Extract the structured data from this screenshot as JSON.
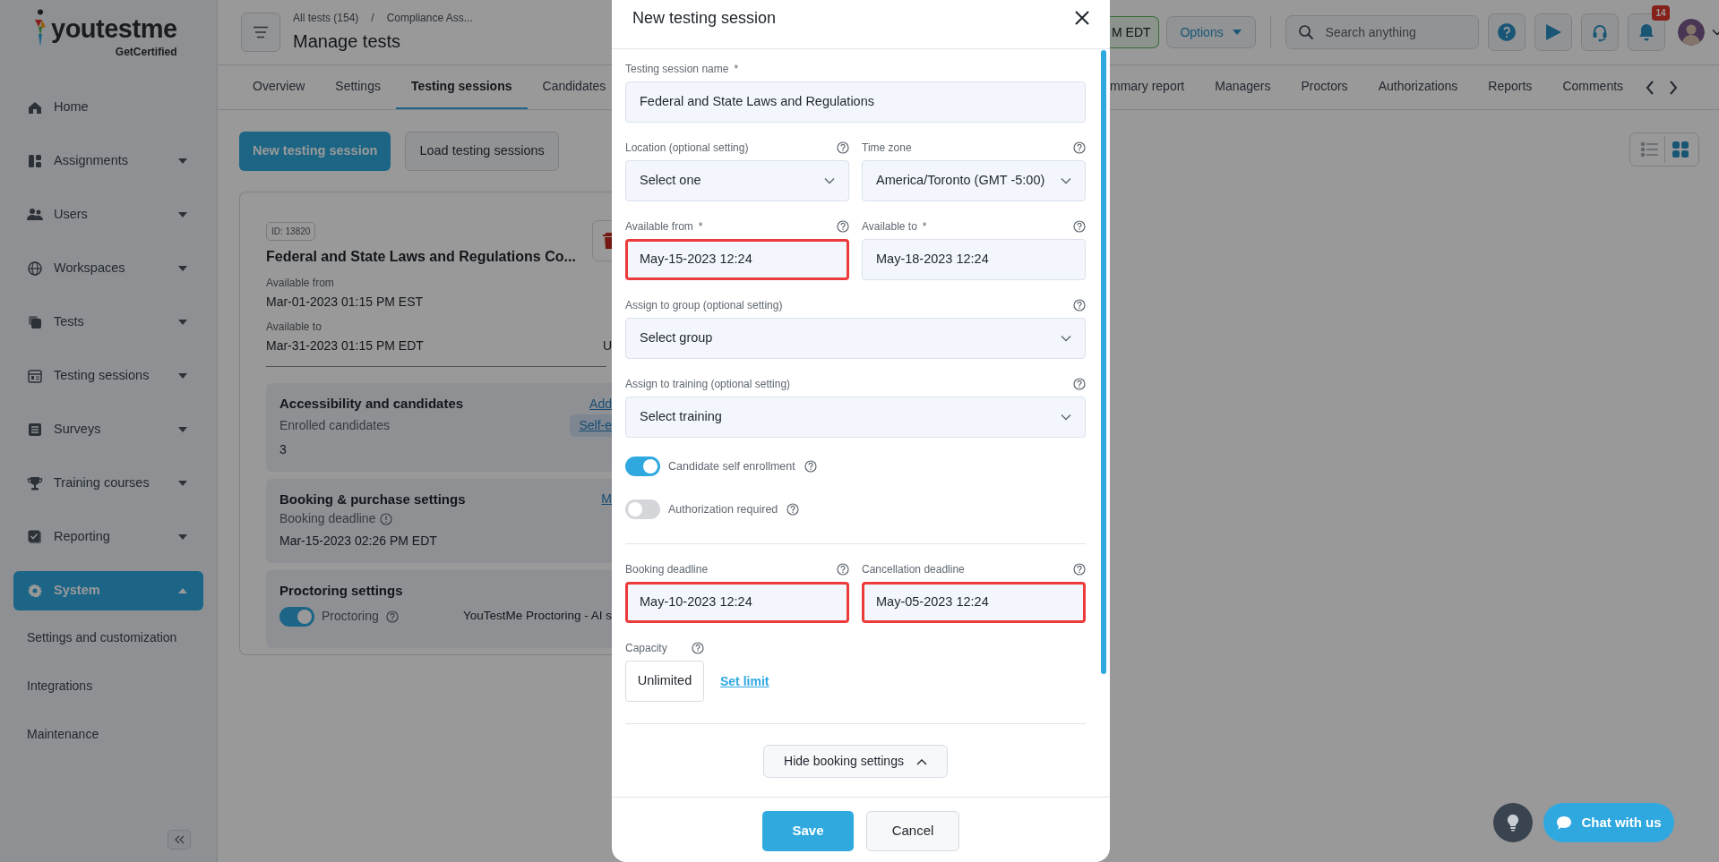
{
  "sidebar": {
    "logo": {
      "name": "youtestme",
      "tagline": "GetCertified"
    },
    "items": [
      {
        "label": "Home",
        "expandable": false,
        "selected": false
      },
      {
        "label": "Assignments",
        "expandable": true,
        "expanded": false,
        "selected": false
      },
      {
        "label": "Users",
        "expandable": true,
        "expanded": false,
        "selected": false
      },
      {
        "label": "Workspaces",
        "expandable": true,
        "expanded": false,
        "selected": false
      },
      {
        "label": "Tests",
        "expandable": true,
        "expanded": false,
        "selected": false
      },
      {
        "label": "Testing sessions",
        "expandable": true,
        "expanded": false,
        "selected": false
      },
      {
        "label": "Surveys",
        "expandable": true,
        "expanded": false,
        "selected": false
      },
      {
        "label": "Training courses",
        "expandable": true,
        "expanded": false,
        "selected": false
      },
      {
        "label": "Reporting",
        "expandable": true,
        "expanded": false,
        "selected": false
      },
      {
        "label": "System",
        "expandable": true,
        "expanded": true,
        "selected": true,
        "children": [
          {
            "label": "Settings and customization"
          },
          {
            "label": "Integrations"
          },
          {
            "label": "Maintenance"
          }
        ]
      }
    ]
  },
  "header": {
    "breadcrumb": [
      "All tests (154)",
      "Compliance Ass..."
    ],
    "breadcrumb_separator": "/",
    "title": "Manage tests",
    "time_chip": "M EDT",
    "options": "Options",
    "search": {
      "placeholder": "Search anything"
    },
    "notifications": "14"
  },
  "tabs_left": [
    {
      "label": "Overview",
      "selected": false
    },
    {
      "label": "Settings",
      "selected": false
    },
    {
      "label": "Testing sessions",
      "selected": true
    },
    {
      "label": "Candidates",
      "selected": false
    }
  ],
  "tabs_right": [
    {
      "label": "mmary report",
      "selected": false
    },
    {
      "label": "Managers",
      "selected": false
    },
    {
      "label": "Proctors",
      "selected": false
    },
    {
      "label": "Authorizations",
      "selected": false
    },
    {
      "label": "Reports",
      "selected": false
    },
    {
      "label": "Comments",
      "selected": false
    }
  ],
  "actions": [
    "New testing session",
    "Load testing sessions"
  ],
  "view_modes": [
    {
      "selected": false
    },
    {
      "selected": true
    }
  ],
  "session_card": {
    "id_badge": "ID: 13820",
    "title": "Federal and State Laws and Regulations Co...",
    "dates": [
      {
        "label": "Available from",
        "value": "Mar-01-2023 01:15 PM EST"
      },
      {
        "label": "Available to",
        "value": "Mar-31-2023 01:15 PM EDT",
        "side": "U"
      }
    ],
    "sections": [
      {
        "title": "Accessibility and candidates",
        "link": "Add",
        "subtitle": "Enrolled candidates",
        "tag": "Self-e",
        "value": "3"
      },
      {
        "title": "Booking & purchase settings",
        "link": "M",
        "subtitle": "Booking deadline",
        "info": true,
        "value": "Mar-15-2023 02:26 PM EDT"
      },
      {
        "title": "Proctoring settings",
        "toggle": {
          "label": "Proctoring",
          "on": true
        },
        "provider": "YouTestMe Proctoring - AI s"
      }
    ]
  },
  "modal": {
    "title": "New testing session",
    "sections": [
      {
        "rows": [
          [
            {
              "kind": "input",
              "label": "Testing session name",
              "required_mark": "*",
              "help": false,
              "value": "Federal and State Laws and Regulations",
              "highlighted": false
            }
          ],
          [
            {
              "kind": "select",
              "label": "Location (optional setting)",
              "help": true,
              "value": "Select one"
            },
            {
              "kind": "select",
              "label": "Time zone",
              "help": true,
              "value": "America/Toronto (GMT -5:00)"
            }
          ],
          [
            {
              "kind": "input",
              "label": "Available from",
              "required_mark": "*",
              "help": true,
              "value": "May-15-2023 12:24",
              "highlighted": true
            },
            {
              "kind": "input",
              "label": "Available to",
              "required_mark": "*",
              "help": true,
              "value": "May-18-2023 12:24",
              "highlighted": false
            }
          ],
          [
            {
              "kind": "select",
              "label": "Assign to group (optional setting)",
              "help": true,
              "value": "Select group"
            }
          ],
          [
            {
              "kind": "select",
              "label": "Assign to training (optional setting)",
              "help": true,
              "value": "Select training"
            }
          ],
          [
            {
              "kind": "toggle",
              "label": "Candidate self enrollment",
              "on": true,
              "help": true
            }
          ],
          [
            {
              "kind": "toggle",
              "label": "Authorization required",
              "on": false,
              "help": true
            }
          ]
        ]
      },
      {
        "rows": [
          [
            {
              "kind": "input",
              "label": "Booking deadline",
              "help": true,
              "value": "May-10-2023 12:24",
              "highlighted": true
            },
            {
              "kind": "input",
              "label": "Cancellation deadline",
              "help": true,
              "value": "May-05-2023 12:24",
              "highlighted": true
            }
          ],
          [
            {
              "kind": "capacity",
              "label": "Capacity",
              "help": true,
              "value": "Unlimited",
              "link": "Set limit"
            }
          ]
        ]
      }
    ],
    "toggle_button": "Hide booking settings",
    "save": "Save",
    "cancel": "Cancel"
  },
  "chat": {
    "label": "Chat with us"
  }
}
